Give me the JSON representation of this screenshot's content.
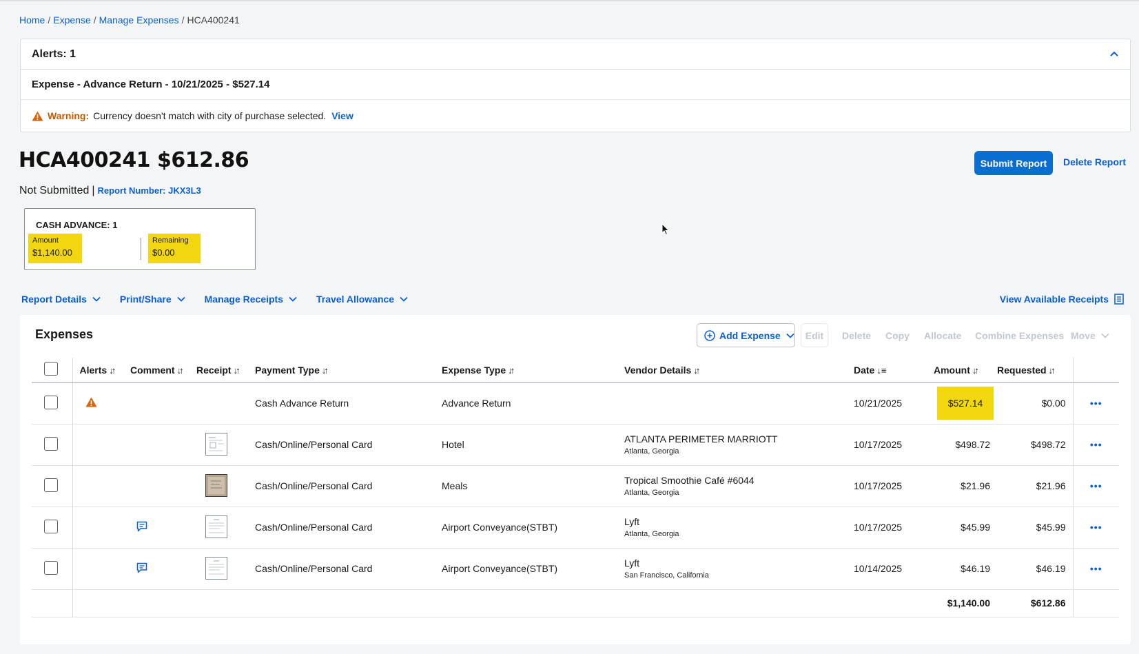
{
  "breadcrumb": {
    "home": "Home",
    "expense": "Expense",
    "manage": "Manage Expenses",
    "current": "HCA400241",
    "sep": "/"
  },
  "alerts": {
    "header": "Alerts: 1",
    "item_title": "Expense - Advance Return - 10/21/2025 - $527.14",
    "warning_label": "Warning:",
    "warning_text": "Currency doesn't match with city of purchase selected.",
    "view_link": "View"
  },
  "report": {
    "title": "HCA400241 $612.86",
    "status": "Not Submitted",
    "separator": "|",
    "report_number": "Report Number: JKX3L3",
    "submit_label": "Submit Report",
    "delete_label": "Delete Report"
  },
  "cash_advance": {
    "title": "CASH ADVANCE: 1",
    "amount_label": "Amount",
    "amount_value": "$1,140.00",
    "remaining_label": "Remaining",
    "remaining_value": "$0.00"
  },
  "menu": {
    "report_details": "Report Details",
    "print_share": "Print/Share",
    "manage_receipts": "Manage Receipts",
    "travel_allowance": "Travel Allowance",
    "view_receipts": "View Available Receipts"
  },
  "expenses": {
    "title": "Expenses",
    "add_label": "Add Expense",
    "toolbar": {
      "edit": "Edit",
      "delete": "Delete",
      "copy": "Copy",
      "allocate": "Allocate",
      "combine": "Combine Expenses",
      "move": "Move"
    },
    "columns": {
      "alerts": "Alerts",
      "comment": "Comment",
      "receipt": "Receipt",
      "payment": "Payment Type",
      "type": "Expense Type",
      "vendor": "Vendor Details",
      "date": "Date",
      "amount": "Amount",
      "requested": "Requested"
    },
    "rows": [
      {
        "payment": "Cash Advance Return",
        "type": "Advance Return",
        "vendor": "",
        "location": "",
        "date": "10/21/2025",
        "amount": "$527.14",
        "requested": "$0.00"
      },
      {
        "payment": "Cash/Online/Personal Card",
        "type": "Hotel",
        "vendor": "ATLANTA PERIMETER MARRIOTT",
        "location": "Atlanta, Georgia",
        "date": "10/17/2025",
        "amount": "$498.72",
        "requested": "$498.72"
      },
      {
        "payment": "Cash/Online/Personal Card",
        "type": "Meals",
        "vendor": "Tropical Smoothie Café #6044",
        "location": "Atlanta, Georgia",
        "date": "10/17/2025",
        "amount": "$21.96",
        "requested": "$21.96"
      },
      {
        "payment": "Cash/Online/Personal Card",
        "type": "Airport Conveyance(STBT)",
        "vendor": "Lyft",
        "location": "Atlanta, Georgia",
        "date": "10/17/2025",
        "amount": "$45.99",
        "requested": "$45.99"
      },
      {
        "payment": "Cash/Online/Personal Card",
        "type": "Airport Conveyance(STBT)",
        "vendor": "Lyft",
        "location": "San Francisco, California",
        "date": "10/14/2025",
        "amount": "$46.19",
        "requested": "$46.19"
      }
    ],
    "totals": {
      "amount": "$1,140.00",
      "requested": "$612.86"
    }
  },
  "colors": {
    "accent": "#0a6ed1",
    "link": "#0a5fd4",
    "highlight": "#f2d60e",
    "warning": "#d9640b"
  }
}
